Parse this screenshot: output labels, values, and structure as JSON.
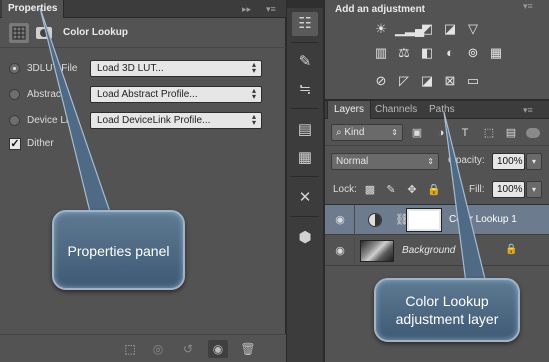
{
  "properties": {
    "tab_label": "Properties",
    "tab_menu_glyphs": "▸▸ ▾≡",
    "header_title": "Color Lookup",
    "rows": [
      {
        "label": "3DLUT File",
        "value": "Load 3D LUT...",
        "selected": true
      },
      {
        "label": "Abstract",
        "value": "Load Abstract Profile...",
        "selected": false
      },
      {
        "label": "Device Link",
        "value": "Load DeviceLink Profile...",
        "selected": false
      }
    ],
    "dither_label": "Dither",
    "dither_checked": true
  },
  "adjustments": {
    "title": "Add an adjustment",
    "tab_menu_glyphs": "▸▸ ▾≡",
    "row1": [
      "brightness-contrast-icon",
      "levels-icon",
      "curves-icon",
      "exposure-icon",
      "gradient-triangle-icon"
    ],
    "row2": [
      "vibrance-icon",
      "color-balance-icon",
      "black-white-icon",
      "photo-filter-icon",
      "channel-mixer-icon",
      "color-lookup-icon"
    ],
    "row3": [
      "invert-icon",
      "posterize-icon",
      "threshold-icon",
      "selective-color-icon",
      "gradient-map-icon"
    ]
  },
  "layers": {
    "tabs": [
      "Layers",
      "Channels",
      "Paths"
    ],
    "kind_label": "Kind",
    "blend_mode": "Normal",
    "opacity_label": "Opacity:",
    "opacity_value": "100%",
    "lock_label": "Lock:",
    "fill_label": "Fill:",
    "fill_value": "100%",
    "items": [
      {
        "name": "Color Lookup 1",
        "selected": true
      },
      {
        "name": "Background",
        "selected": false
      }
    ]
  },
  "callouts": {
    "properties": "Properties panel",
    "adjustment": "Color Lookup adjustment layer"
  },
  "colors": {
    "panel": "#535353",
    "dark": "#3c3c3c",
    "selected_layer": "#6c7c8e",
    "callout": "#4b6782"
  }
}
